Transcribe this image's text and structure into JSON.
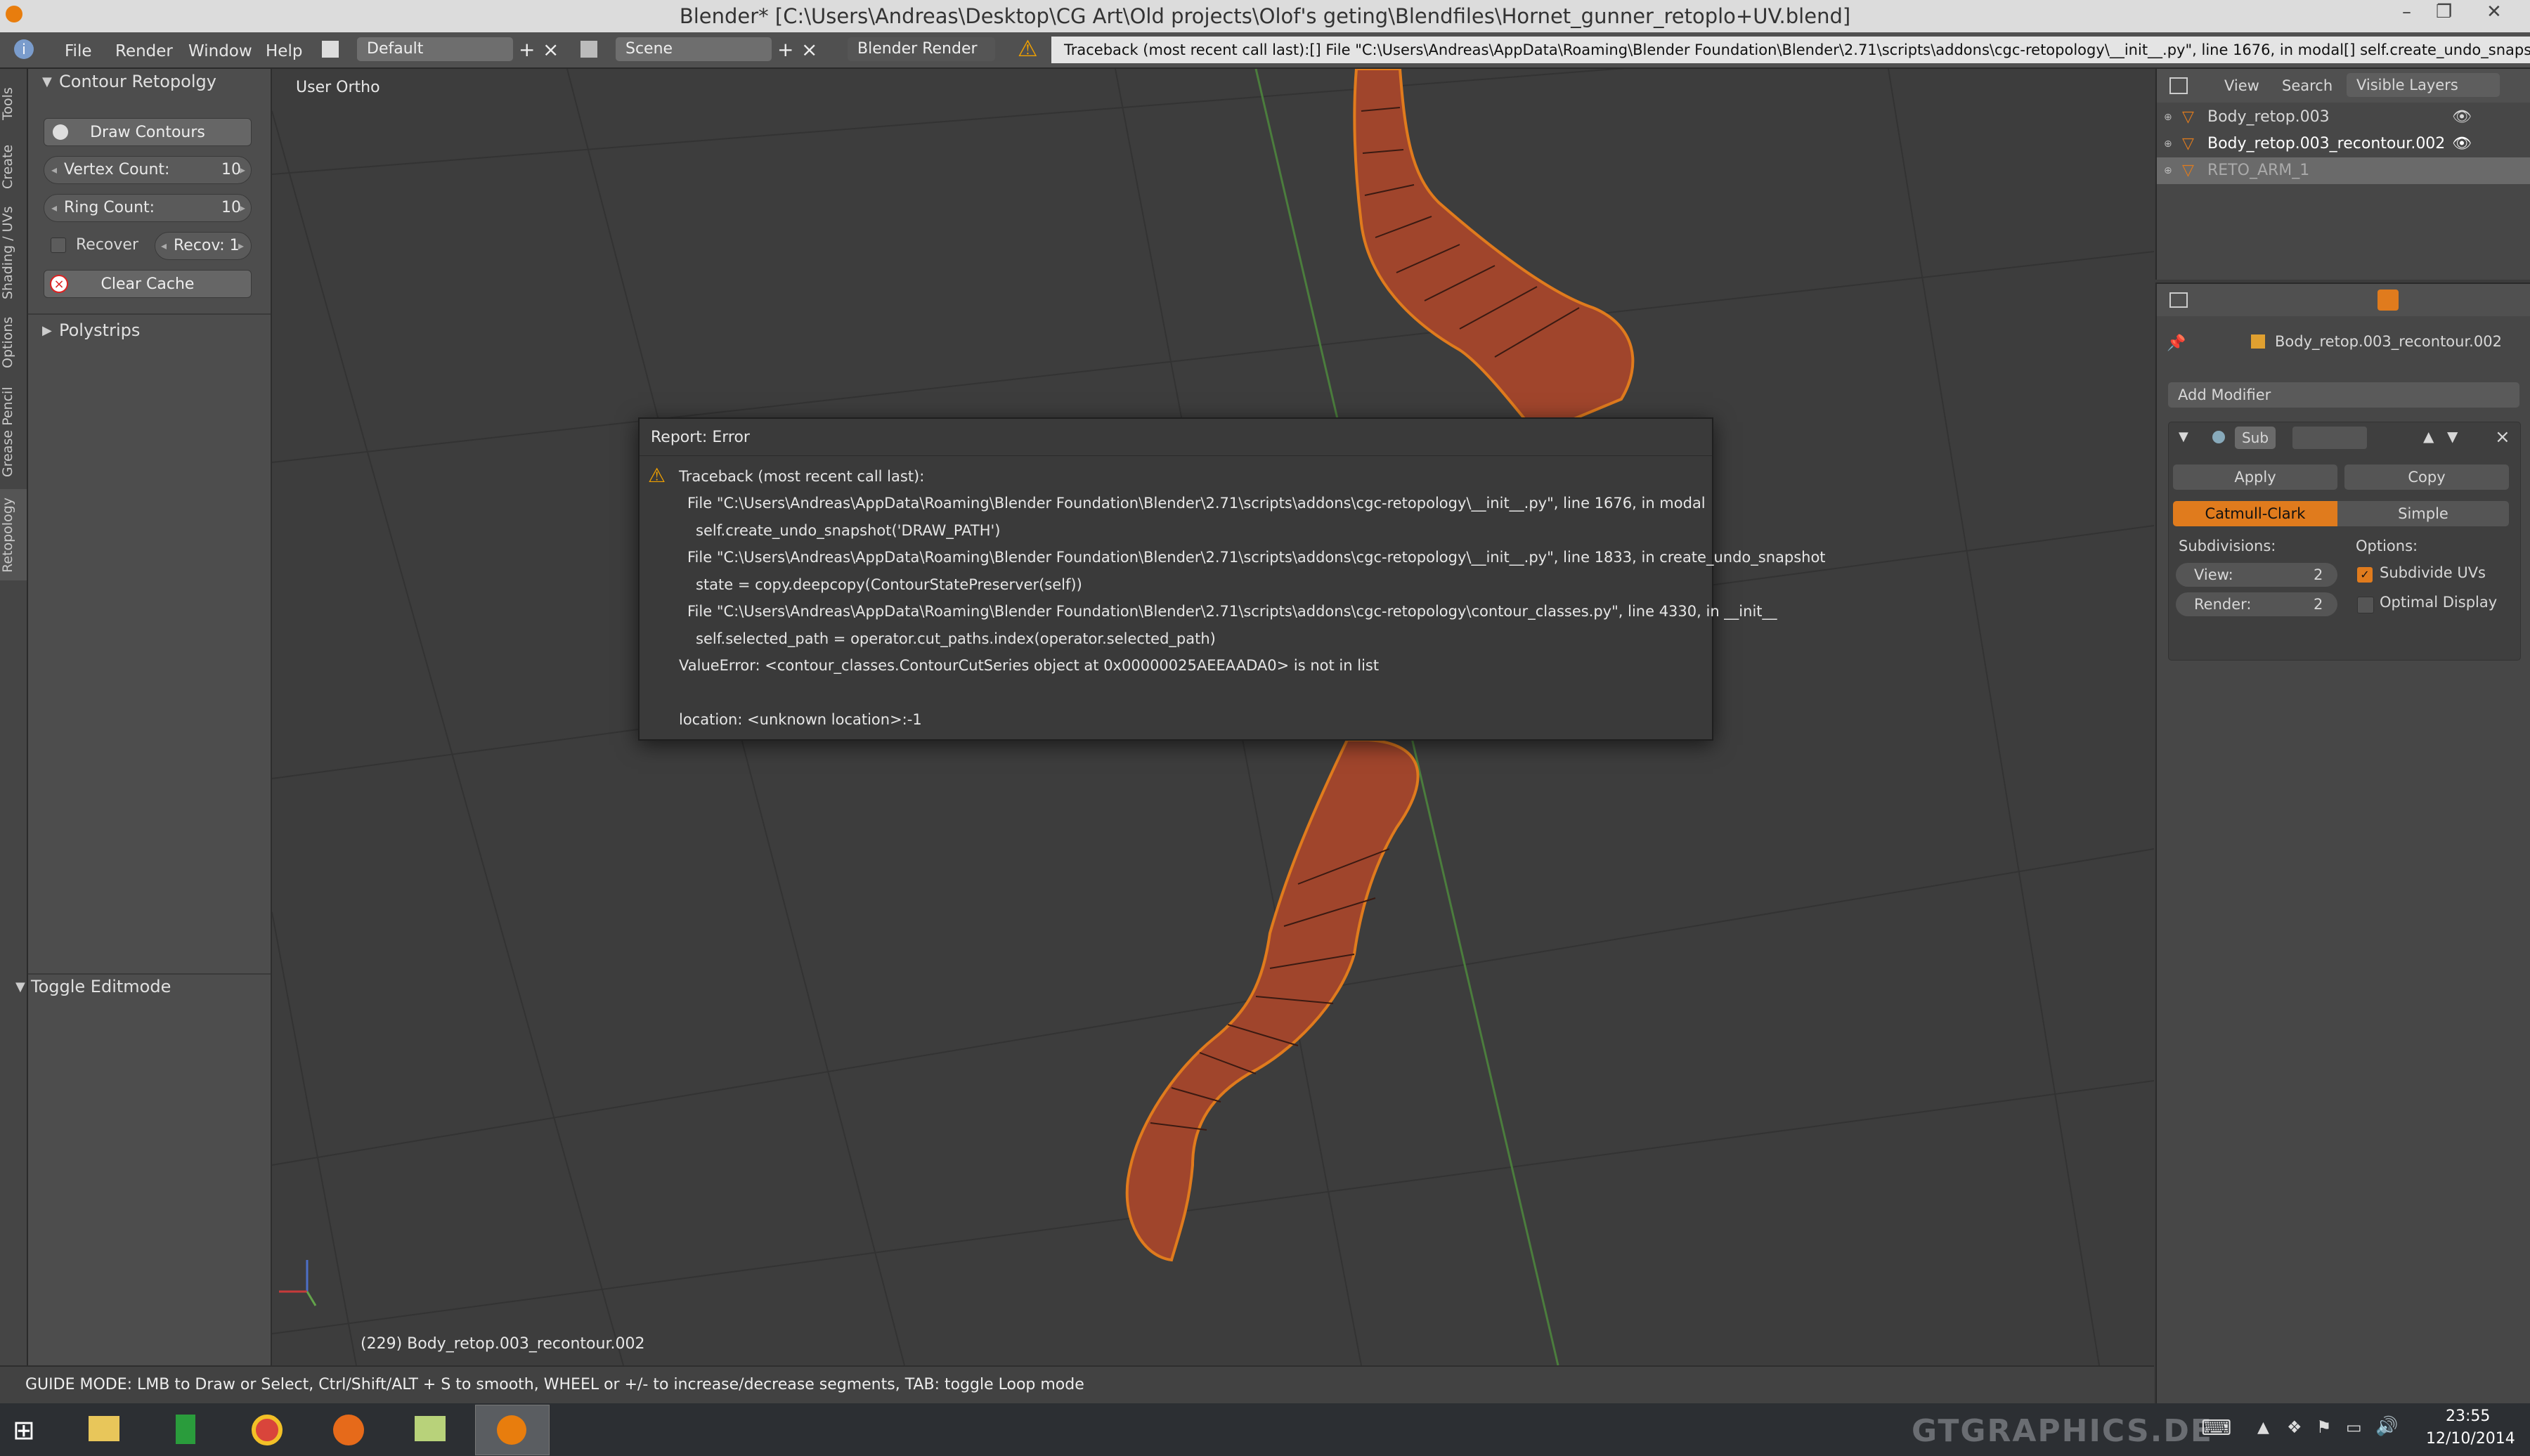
{
  "window": {
    "title": "Blender* [C:\\Users\\Andreas\\Desktop\\CG Art\\Old projects\\Olof's geting\\Blendfiles\\Hornet_gunner_retoplo+UV.blend]",
    "minimize": "–",
    "maximize": "❐",
    "close": "✕"
  },
  "header": {
    "menus": [
      "File",
      "Render",
      "Window",
      "Help"
    ],
    "layout": "Default",
    "scene": "Scene",
    "engine": "Blender Render",
    "warning": "Traceback (most recent call last):[] File \"C:\\Users\\Andreas\\AppData\\Roaming\\Blender Foundation\\Blender\\2.71\\scripts\\addons\\cgc-retopology\\__init__.py\", line 1676, in modal[]   self.create_undo_snapshot('DRAW_PATH')[] Fi"
  },
  "tabs": [
    "Tools",
    "Create",
    "Shading / UVs",
    "Options",
    "Grease Pencil",
    "Retopology"
  ],
  "toolshelf": {
    "panel_title": "Contour Retopolgy",
    "draw_contours": "Draw Contours",
    "vertex_count_label": "Vertex Count:",
    "vertex_count": "10",
    "ring_count_label": "Ring Count:",
    "ring_count": "10",
    "recover_label": "Recover",
    "recov_value": "Recov: 1",
    "clear_cache": "Clear Cache",
    "polystrips": "Polystrips",
    "toggle_editmode": "Toggle Editmode"
  },
  "viewport": {
    "view_name": "User Ortho",
    "object_info": "(229) Body_retop.003_recontour.002"
  },
  "dialog": {
    "title": "Report: Error",
    "lines": [
      "Traceback (most recent call last):",
      "File \"C:\\Users\\Andreas\\AppData\\Roaming\\Blender Foundation\\Blender\\2.71\\scripts\\addons\\cgc-retopology\\__init__.py\", line 1676, in modal",
      "self.create_undo_snapshot('DRAW_PATH')",
      "File \"C:\\Users\\Andreas\\AppData\\Roaming\\Blender Foundation\\Blender\\2.71\\scripts\\addons\\cgc-retopology\\__init__.py\", line 1833, in create_undo_snapshot",
      "state = copy.deepcopy(ContourStatePreserver(self))",
      "File \"C:\\Users\\Andreas\\AppData\\Roaming\\Blender Foundation\\Blender\\2.71\\scripts\\addons\\cgc-retopology\\contour_classes.py\", line 4330, in __init__",
      "self.selected_path = operator.cut_paths.index(operator.selected_path)",
      "ValueError: <contour_classes.ContourCutSeries object at 0x00000025AEEAADA0> is not in list",
      "location: <unknown location>:-1"
    ]
  },
  "statusbar": {
    "text": "GUIDE MODE: LMB to Draw or Select, Ctrl/Shift/ALT + S to smooth, WHEEL or +/- to increase/decrease segments, TAB: toggle Loop mode"
  },
  "outliner": {
    "tabs": [
      "View",
      "Search",
      "Visible Layers"
    ],
    "items": [
      "Body_retop.003",
      "Body_retop.003_recontour.002",
      "RETO_ARM_1"
    ]
  },
  "properties": {
    "object_name": "Body_retop.003_recontour.002",
    "add_modifier": "Add Modifier",
    "modifier_name": "Sub",
    "apply": "Apply",
    "copy": "Copy",
    "catmull_clark": "Catmull-Clark",
    "simple": "Simple",
    "subdivisions_label": "Subdivisions:",
    "options_label": "Options:",
    "view_label": "View:",
    "view_value": "2",
    "render_label": "Render:",
    "render_value": "2",
    "subdivide_uvs": "Subdivide UVs",
    "subdivide_uvs_checked": true,
    "optimal_display": "Optimal Display",
    "optimal_display_checked": false
  },
  "taskbar": {
    "time": "23:55",
    "date": "12/10/2014",
    "watermark": "GTGRAPHICS.DE"
  },
  "colors": {
    "mesh": "#a0452c",
    "accent": "#e07b1d",
    "x_axis": "#c83a3a",
    "y_axis": "#63a34a",
    "z_axis": "#4d6fc6"
  }
}
